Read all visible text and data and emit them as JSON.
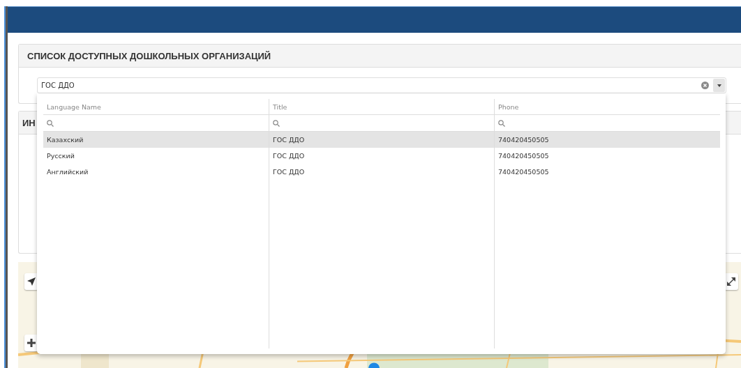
{
  "panels": [
    {
      "title": "СПИСОК ДОСТУПНЫХ ДОШКОЛЬНЫХ ОРГАНИЗАЦИЙ"
    },
    {
      "title": "ИН"
    }
  ],
  "combo": {
    "value": "ГОС ДДО"
  },
  "grid": {
    "columns": [
      "Language Name",
      "Title",
      "Phone"
    ],
    "rows": [
      {
        "cells": [
          "Казахский",
          "ГОС ДДО",
          "740420450505"
        ],
        "selected": true
      },
      {
        "cells": [
          "Русский",
          "ГОС ДДО",
          "740420450505"
        ],
        "selected": false
      },
      {
        "cells": [
          "Английский",
          "ГОС ДДО",
          "740420450505"
        ],
        "selected": false
      }
    ]
  }
}
